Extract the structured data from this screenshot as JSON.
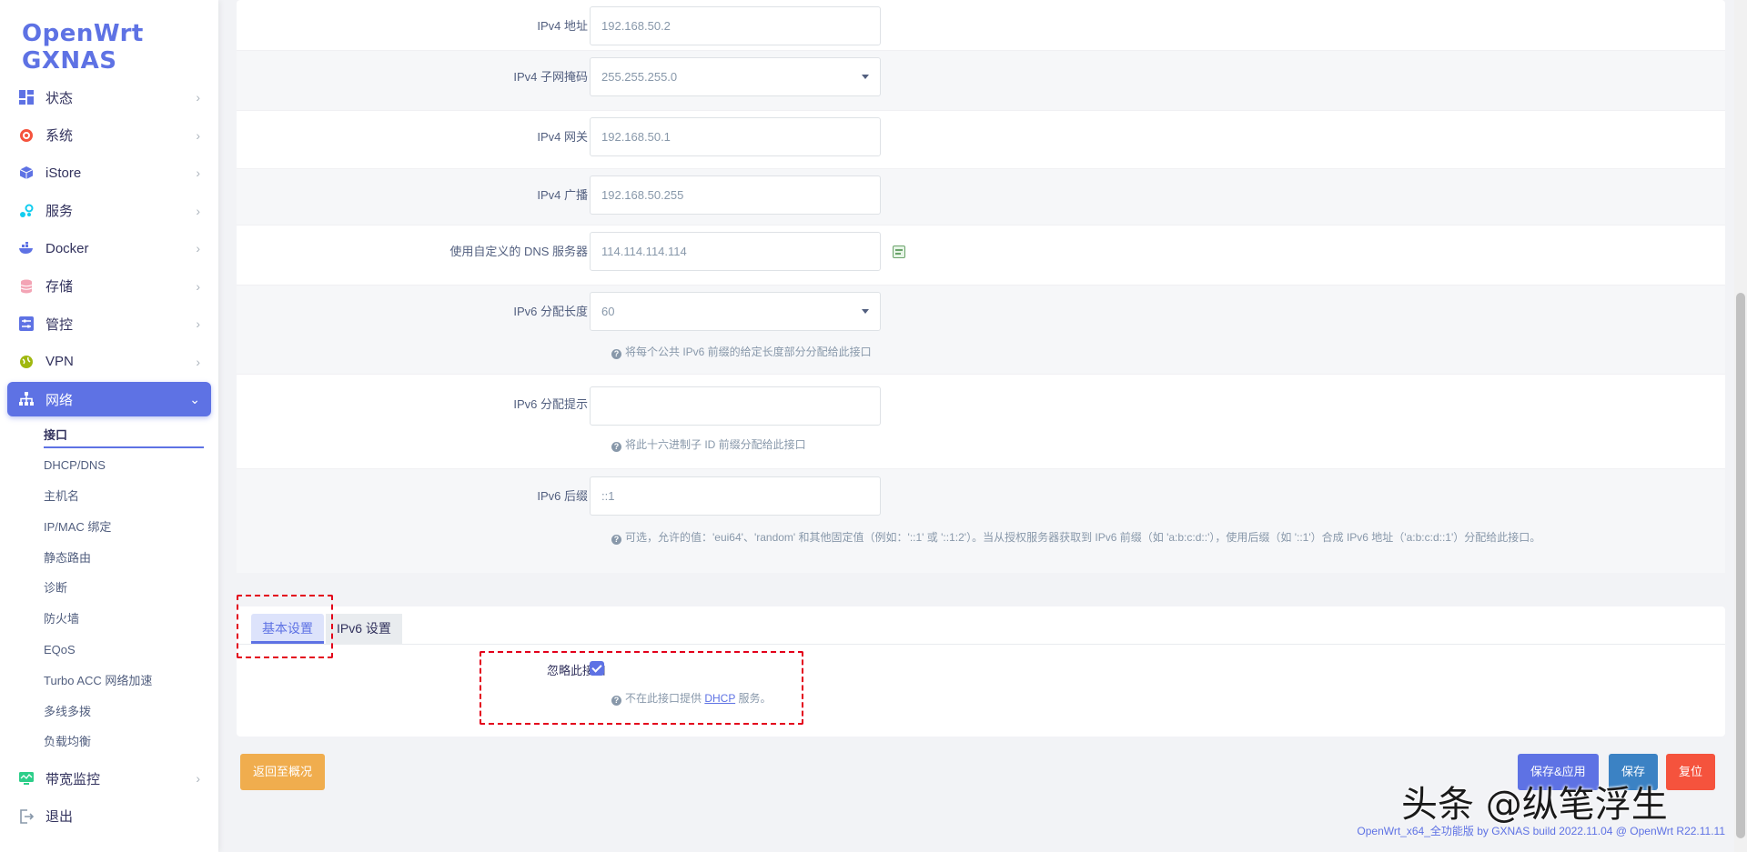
{
  "brand": "OpenWrt GXNAS",
  "nav": {
    "items": [
      {
        "label": "状态",
        "icon": "dashboard-icon",
        "color": "#5e72e4"
      },
      {
        "label": "系统",
        "icon": "gear-icon",
        "color": "#f5533d"
      },
      {
        "label": "iStore",
        "icon": "cube-icon",
        "color": "#5e72e4"
      },
      {
        "label": "服务",
        "icon": "services-icon",
        "color": "#11cdef"
      },
      {
        "label": "Docker",
        "icon": "docker-icon",
        "color": "#5e72e4"
      },
      {
        "label": "存储",
        "icon": "database-icon",
        "color": "#f3a4b5"
      },
      {
        "label": "管控",
        "icon": "sliders-icon",
        "color": "#5e72e4"
      },
      {
        "label": "VPN",
        "icon": "globe-icon",
        "color": "#a0b80f"
      }
    ],
    "active": {
      "label": "网络",
      "icon": "network-icon"
    },
    "sub_items": [
      "接口",
      "DHCP/DNS",
      "主机名",
      "IP/MAC 绑定",
      "静态路由",
      "诊断",
      "防火墙",
      "EQoS",
      "Turbo ACC 网络加速",
      "多线多拨",
      "负载均衡"
    ],
    "after": [
      {
        "label": "带宽监控",
        "icon": "monitor-icon",
        "color": "#2dce89"
      },
      {
        "label": "退出",
        "icon": "logout-icon",
        "color": "#8898aa"
      }
    ]
  },
  "form": {
    "ipv4_addr": {
      "label": "IPv4 地址",
      "value": "192.168.50.2"
    },
    "ipv4_mask": {
      "label": "IPv4 子网掩码",
      "value": "255.255.255.0"
    },
    "ipv4_gw": {
      "label": "IPv4 网关",
      "value": "192.168.50.1"
    },
    "ipv4_bcast": {
      "label": "IPv4 广播",
      "value": "192.168.50.255"
    },
    "dns": {
      "label": "使用自定义的 DNS 服务器",
      "value": "114.114.114.114"
    },
    "ip6_assign": {
      "label": "IPv6 分配长度",
      "value": "60",
      "hint": "将每个公共 IPv6 前缀的给定长度部分分配给此接口"
    },
    "ip6_hint": {
      "label": "IPv6 分配提示",
      "value": "",
      "hint": "将此十六进制子 ID 前缀分配给此接口"
    },
    "ip6_suffix": {
      "label": "IPv6 后缀",
      "value": "::1",
      "hint": "可选，允许的值：'eui64'、'random' 和其他固定值（例如：'::1' 或 '::1:2'）。当从授权服务器获取到 IPv6 前缀（如 'a:b:c:d::'），使用后缀（如 '::1'）合成 IPv6 地址（'a:b:c:d::1'）分配给此接口。"
    }
  },
  "dhcp": {
    "tabs": [
      "基本设置",
      "IPv6 设置"
    ],
    "ignore_label": "忽略此接口",
    "ignore_checked": true,
    "hint_prefix": "不在此接口提供 ",
    "hint_link": "DHCP",
    "hint_suffix": " 服务。"
  },
  "buttons": {
    "back": "返回至概况",
    "save_apply": "保存&应用",
    "save": "保存",
    "reset": "复位"
  },
  "watermark": "头条 @纵笔浮生",
  "footer": "OpenWrt_x64_全功能版 by GXNAS build 2022.11.04 @ OpenWrt R22.11.11"
}
